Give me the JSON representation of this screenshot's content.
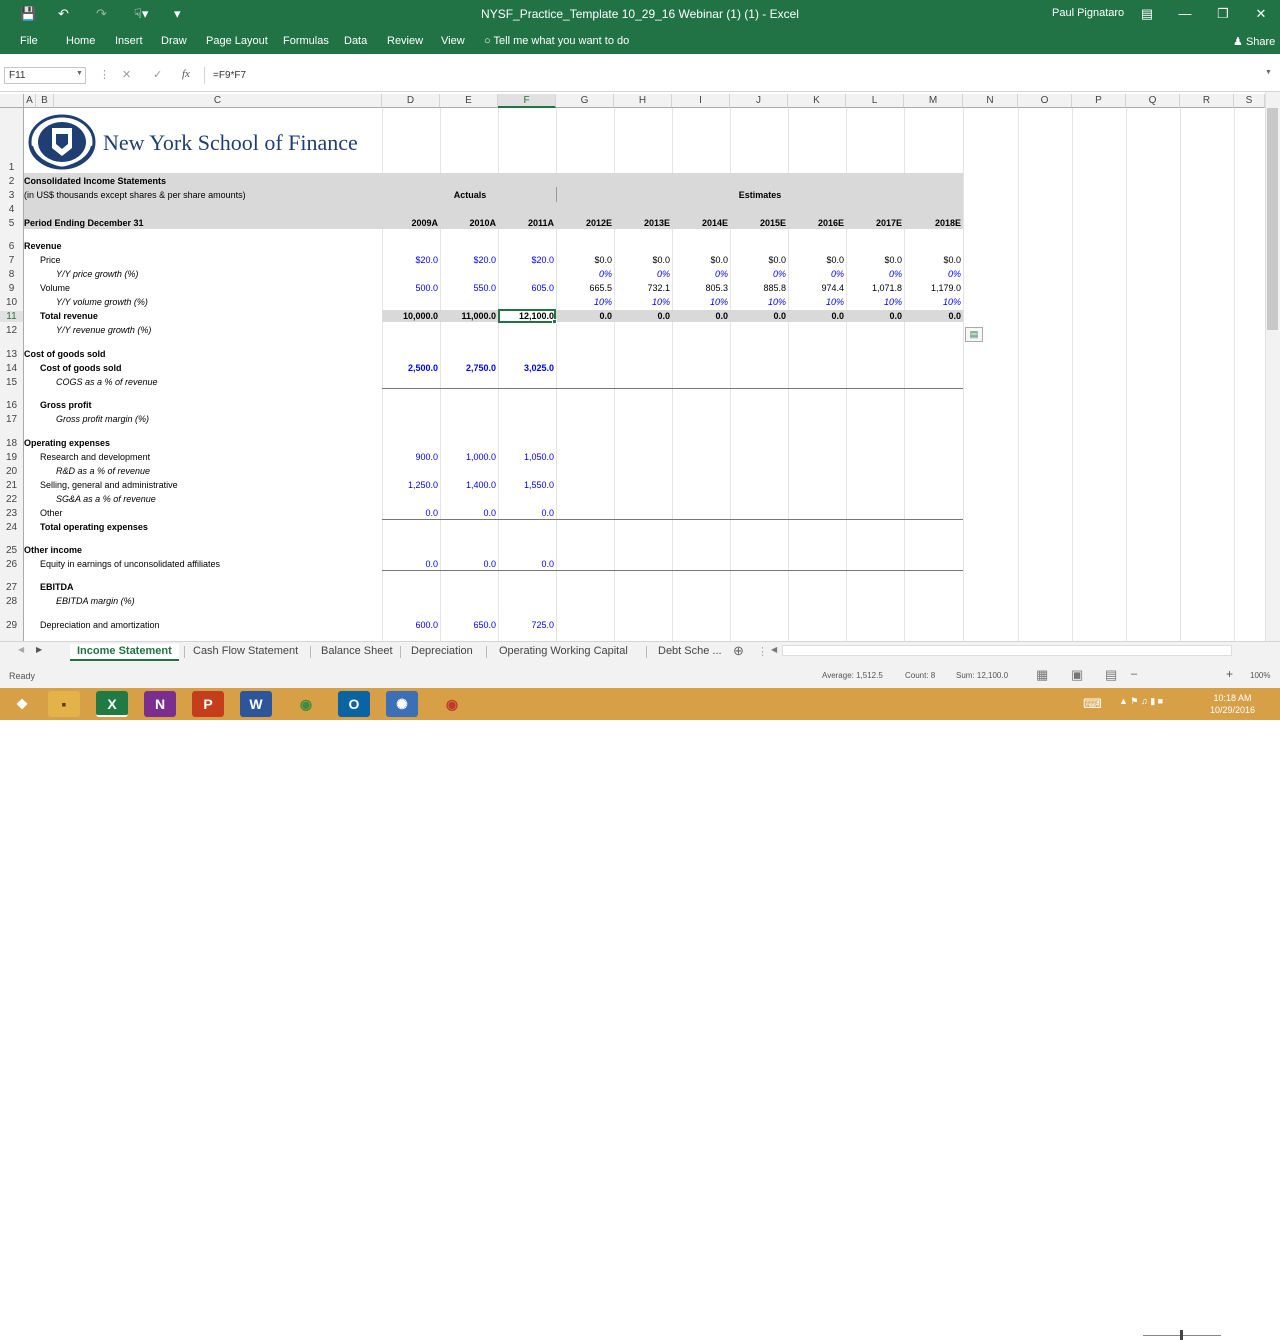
{
  "app": {
    "title": "NYSF_Practice_Template 10_29_16 Webinar (1) (1)  -  Excel",
    "user": "Paul Pignataro"
  },
  "ribbon": {
    "tabs": [
      "File",
      "Home",
      "Insert",
      "Draw",
      "Page Layout",
      "Formulas",
      "Data",
      "Review",
      "View"
    ],
    "tell_me": "Tell me what you want to do",
    "share": "Share"
  },
  "formula": {
    "name_box": "F11",
    "fx": "fx",
    "content": "=F9*F7"
  },
  "columns": [
    "A",
    "B",
    "C",
    "D",
    "E",
    "F",
    "G",
    "H",
    "I",
    "J",
    "K",
    "L",
    "M",
    "N",
    "O",
    "P",
    "Q",
    "R",
    "S"
  ],
  "rows": [
    "1",
    "2",
    "3",
    "4",
    "5",
    "6",
    "7",
    "8",
    "9",
    "10",
    "11",
    "12",
    "13",
    "14",
    "15",
    "16",
    "17",
    "18",
    "19",
    "20",
    "21",
    "22",
    "23",
    "24",
    "25",
    "26",
    "27",
    "28",
    "29"
  ],
  "logo_text": "New York School of Finance",
  "sheet": {
    "title": "Consolidated Income Statements",
    "subtitle": "(in US$ thousands except shares & per share amounts)",
    "period": "Period Ending December 31",
    "actuals": "Actuals",
    "estimates": "Estimates",
    "years": [
      "2009A",
      "2010A",
      "2011A",
      "2012E",
      "2013E",
      "2014E",
      "2015E",
      "2016E",
      "2017E",
      "2018E"
    ],
    "labels": {
      "revenue": "Revenue",
      "price": "Price",
      "price_growth": "Y/Y price growth (%)",
      "volume": "Volume",
      "volume_growth": "Y/Y volume growth (%)",
      "total_revenue": "Total revenue",
      "revenue_growth": "Y/Y revenue growth (%)",
      "cogs_header": "Cost of goods sold",
      "cogs": "Cost of goods sold",
      "cogs_pct": "COGS as a % of revenue",
      "gross_profit": "Gross profit",
      "gross_margin": "Gross profit margin (%)",
      "opex_header": "Operating expenses",
      "rd": "Research and development",
      "rd_pct": "R&D as a % of revenue",
      "sga": "Selling, general and administrative",
      "sga_pct": "SG&A as a % of revenue",
      "other": "Other",
      "total_opex": "Total operating expenses",
      "other_income": "Other income",
      "equity": "Equity in earnings of unconsolidated affiliates",
      "ebitda": "EBITDA",
      "ebitda_margin": "EBITDA margin (%)",
      "da": "Depreciation and amortization"
    },
    "price": [
      "$20.0",
      "$20.0",
      "$20.0",
      "$0.0",
      "$0.0",
      "$0.0",
      "$0.0",
      "$0.0",
      "$0.0",
      "$0.0"
    ],
    "price_growth": [
      "",
      "",
      "",
      "0%",
      "0%",
      "0%",
      "0%",
      "0%",
      "0%",
      "0%"
    ],
    "volume": [
      "500.0",
      "550.0",
      "605.0",
      "665.5",
      "732.1",
      "805.3",
      "885.8",
      "974.4",
      "1,071.8",
      "1,179.0"
    ],
    "volume_growth": [
      "",
      "",
      "",
      "10%",
      "10%",
      "10%",
      "10%",
      "10%",
      "10%",
      "10%"
    ],
    "total_revenue": [
      "10,000.0",
      "11,000.0",
      "12,100.0",
      "0.0",
      "0.0",
      "0.0",
      "0.0",
      "0.0",
      "0.0",
      "0.0"
    ],
    "cogs": [
      "2,500.0",
      "2,750.0",
      "3,025.0"
    ],
    "rd": [
      "900.0",
      "1,000.0",
      "1,050.0"
    ],
    "sga": [
      "1,250.0",
      "1,400.0",
      "1,550.0"
    ],
    "other": [
      "0.0",
      "0.0",
      "0.0"
    ],
    "equity": [
      "0.0",
      "0.0",
      "0.0"
    ],
    "da": [
      "600.0",
      "650.0",
      "725.0"
    ]
  },
  "sheet_tabs": [
    "Income Statement",
    "Cash Flow Statement",
    "Balance Sheet",
    "Depreciation",
    "Operating Working Capital",
    "Debt Sche ..."
  ],
  "status": {
    "ready": "Ready",
    "average": "Average: 1,512.5",
    "count": "Count: 8",
    "sum": "Sum: 12,100.0",
    "zoom": "100%"
  },
  "taskbar": {
    "time": "10:18 AM",
    "date": "10/29/2016"
  },
  "colors": {
    "excel_green": "#217346",
    "taskbar": "#d7a047",
    "input_blue": "#0000ff"
  }
}
